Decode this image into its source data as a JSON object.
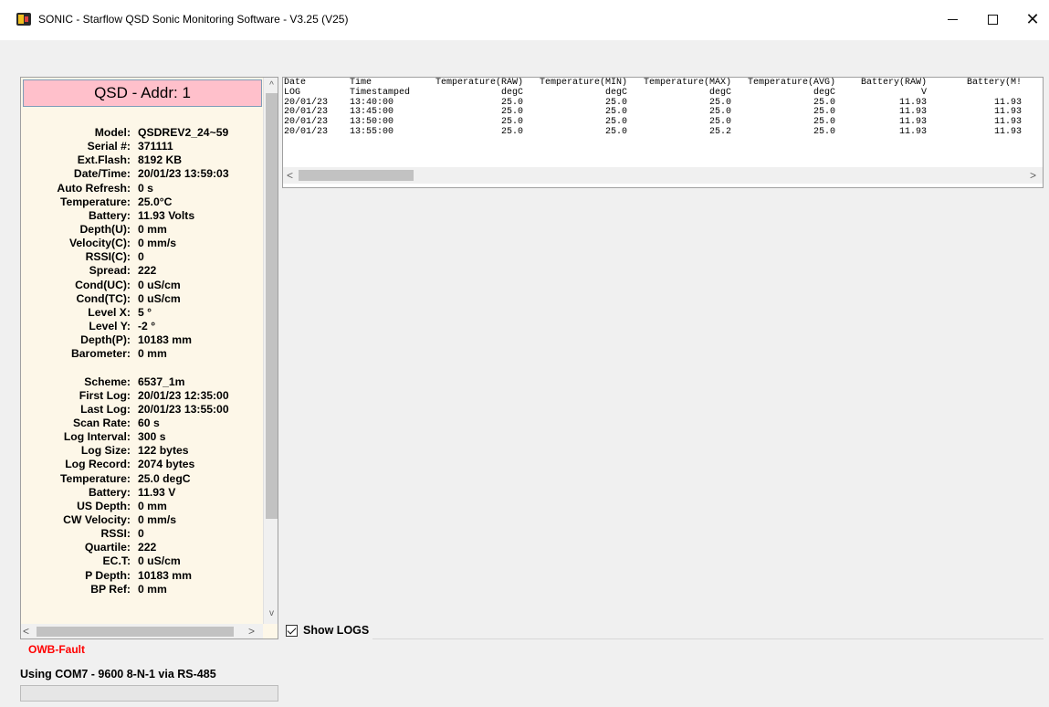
{
  "window": {
    "title": "SONIC - Starflow QSD Sonic Monitoring Software - V3.25 (V25)",
    "icons": [
      "app-icon",
      "minimize-icon",
      "maximize-icon",
      "close-icon"
    ]
  },
  "left_panel": {
    "header": "QSD - Addr:  1",
    "rows": [
      {
        "label": "Model:",
        "value": "QSDREV2_24~59"
      },
      {
        "label": "Serial #:",
        "value": "371111"
      },
      {
        "label": "Ext.Flash:",
        "value": "8192 KB"
      },
      {
        "label": "Date/Time:",
        "value": "20/01/23  13:59:03"
      },
      {
        "label": "Auto Refresh:",
        "value": "0 s"
      },
      {
        "label": "Temperature:",
        "value": "25.0°C"
      },
      {
        "label": "Battery:",
        "value": "11.93 Volts"
      },
      {
        "label": "Depth(U):",
        "value": "0 mm"
      },
      {
        "label": "Velocity(C):",
        "value": "0 mm/s"
      },
      {
        "label": "RSSI(C):",
        "value": "0"
      },
      {
        "label": "Spread:",
        "value": "222"
      },
      {
        "label": "Cond(UC):",
        "value": "0 uS/cm"
      },
      {
        "label": "Cond(TC):",
        "value": "0 uS/cm"
      },
      {
        "label": "Level X:",
        "value": "5 °"
      },
      {
        "label": "Level Y:",
        "value": "-2 °"
      },
      {
        "label": "Depth(P):",
        "value": "10183 mm"
      },
      {
        "label": "Barometer:",
        "value": "0 mm"
      },
      {
        "label": "",
        "value": ""
      },
      {
        "label": "Scheme:",
        "value": "6537_1m"
      },
      {
        "label": "First Log:",
        "value": "20/01/23  12:35:00"
      },
      {
        "label": "Last Log:",
        "value": "20/01/23  13:55:00"
      },
      {
        "label": "Scan Rate:",
        "value": "60 s"
      },
      {
        "label": "Log Interval:",
        "value": "300 s"
      },
      {
        "label": "Log Size:",
        "value": "122 bytes"
      },
      {
        "label": "Log Record:",
        "value": "2074 bytes"
      },
      {
        "label": "Temperature:",
        "value": "25.0 degC"
      },
      {
        "label": "Battery:",
        "value": "11.93 V"
      },
      {
        "label": "US Depth:",
        "value": "0 mm"
      },
      {
        "label": "CW Velocity:",
        "value": "0 mm/s"
      },
      {
        "label": "RSSI:",
        "value": "0"
      },
      {
        "label": "Quartile:",
        "value": "222"
      },
      {
        "label": "EC.T:",
        "value": "0 uS/cm"
      },
      {
        "label": "P Depth:",
        "value": "10183 mm"
      },
      {
        "label": "BP Ref:",
        "value": "0 mm"
      }
    ]
  },
  "status": {
    "fault": "OWB-Fault",
    "connection": "Using COM7 - 9600 8-N-1 via RS-485",
    "progress": 0
  },
  "log_grid": {
    "headers": [
      "Date",
      "Time",
      "Temperature(RAW)",
      "Temperature(MIN)",
      "Temperature(MAX)",
      "Temperature(AVG)",
      "Battery(RAW)",
      "Battery(M!"
    ],
    "units": [
      "LOG",
      "Timestamped",
      "degC",
      "degC",
      "degC",
      "degC",
      "V",
      ""
    ],
    "rows": [
      [
        "20/01/23",
        "13:40:00",
        "25.0",
        "25.0",
        "25.0",
        "25.0",
        "11.93",
        "11.93"
      ],
      [
        "20/01/23",
        "13:45:00",
        "25.0",
        "25.0",
        "25.0",
        "25.0",
        "11.93",
        "11.93"
      ],
      [
        "20/01/23",
        "13:50:00",
        "25.0",
        "25.0",
        "25.0",
        "25.0",
        "11.93",
        "11.93"
      ],
      [
        "20/01/23",
        "13:55:00",
        "25.0",
        "25.0",
        "25.2",
        "25.0",
        "11.93",
        "11.93"
      ]
    ]
  },
  "show_logs": {
    "label": "Show LOGS",
    "checked": true
  },
  "glyphs": {
    "up": "^",
    "down": "v",
    "left": "<",
    "right": ">",
    "close": "✕"
  }
}
